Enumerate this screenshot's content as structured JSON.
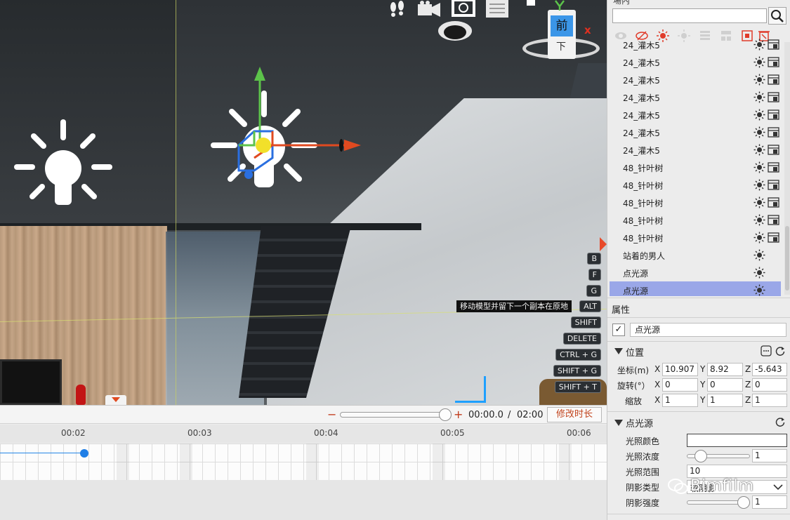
{
  "viewport": {
    "view_cube": {
      "front_label": "前",
      "down_label": "下"
    },
    "shortcut_tip": "移动模型并留下一个副本在原地",
    "shortcut_keys": [
      "B",
      "F",
      "G",
      "ALT",
      "SHIFT",
      "DELETE",
      "CTRL + G",
      "SHIFT + G",
      "SHIFT + T"
    ],
    "gizmo_colors": {
      "x_axis": "#e04a20",
      "y_axis": "#5cc34a",
      "z_axis": "#2a6fe0",
      "center": "#f2e02a"
    },
    "icons": [
      "light-bulb-icon",
      "footprints-icon",
      "camera-icon",
      "screenshot-icon",
      "layers-icon"
    ]
  },
  "timeline": {
    "current_time": "00:00.0",
    "separator": "/",
    "total_time": "02:00",
    "modify_duration_button": "修改时长",
    "ticks": [
      "00:02",
      "00:03",
      "00:04",
      "00:05",
      "00:06"
    ],
    "zoom_level": 0.95
  },
  "panel": {
    "title": "場內",
    "search": {
      "value": "",
      "placeholder": ""
    },
    "toolbar_icons": [
      "eye-icon",
      "eye-hidden-icon",
      "light-on-icon",
      "light-off-icon",
      "list-icon",
      "group-icon",
      "focus-icon",
      "delete-icon"
    ],
    "scene_items": [
      {
        "label": "24_灌木5",
        "lock": true
      },
      {
        "label": "24_灌木5",
        "lock": true
      },
      {
        "label": "24_灌木5",
        "lock": true
      },
      {
        "label": "24_灌木5",
        "lock": true
      },
      {
        "label": "24_灌木5",
        "lock": true
      },
      {
        "label": "24_灌木5",
        "lock": true
      },
      {
        "label": "24_灌木5",
        "lock": true
      },
      {
        "label": "48_针叶树",
        "lock": true
      },
      {
        "label": "48_针叶树",
        "lock": true
      },
      {
        "label": "48_针叶树",
        "lock": true
      },
      {
        "label": "48_针叶树",
        "lock": true
      },
      {
        "label": "48_针叶树",
        "lock": true
      },
      {
        "label": "站着的男人",
        "lock": false
      },
      {
        "label": "点光源",
        "lock": false
      },
      {
        "label": "点光源",
        "lock": false,
        "selected": true
      }
    ],
    "properties": {
      "header": "属性",
      "enabled": true,
      "object_name": "点光源",
      "position_section": {
        "title": "位置",
        "rows": [
          {
            "label": "坐标(m)",
            "x": "10.907",
            "y": "8.92",
            "z": "-5.643"
          },
          {
            "label": "旋转(°）",
            "x": "0",
            "y": "0",
            "z": "0"
          },
          {
            "label": "缩放",
            "x": "1",
            "y": "1",
            "z": "1"
          }
        ],
        "axis_labels": [
          "X",
          "Y",
          "Z"
        ]
      },
      "light_section": {
        "title": "点光源",
        "color_label": "光照颜色",
        "color_value": "#ffffff",
        "intensity_label": "光照浓度",
        "intensity_value": "1",
        "intensity_level": 0.15,
        "range_label": "光照范围",
        "range_value": "10",
        "shadow_type_label": "阴影类型",
        "shadow_type_value": "软阴影",
        "shadow_strength_label": "阴影强度",
        "shadow_strength_value": "1",
        "shadow_strength_level": 1.0
      }
    }
  },
  "watermark": "Bimfilm",
  "colors": {
    "selection": "#9aa7e8",
    "accent": "#c2451e",
    "timeline_marker": "#1e7ee6",
    "view_front": "#3b96e8"
  }
}
